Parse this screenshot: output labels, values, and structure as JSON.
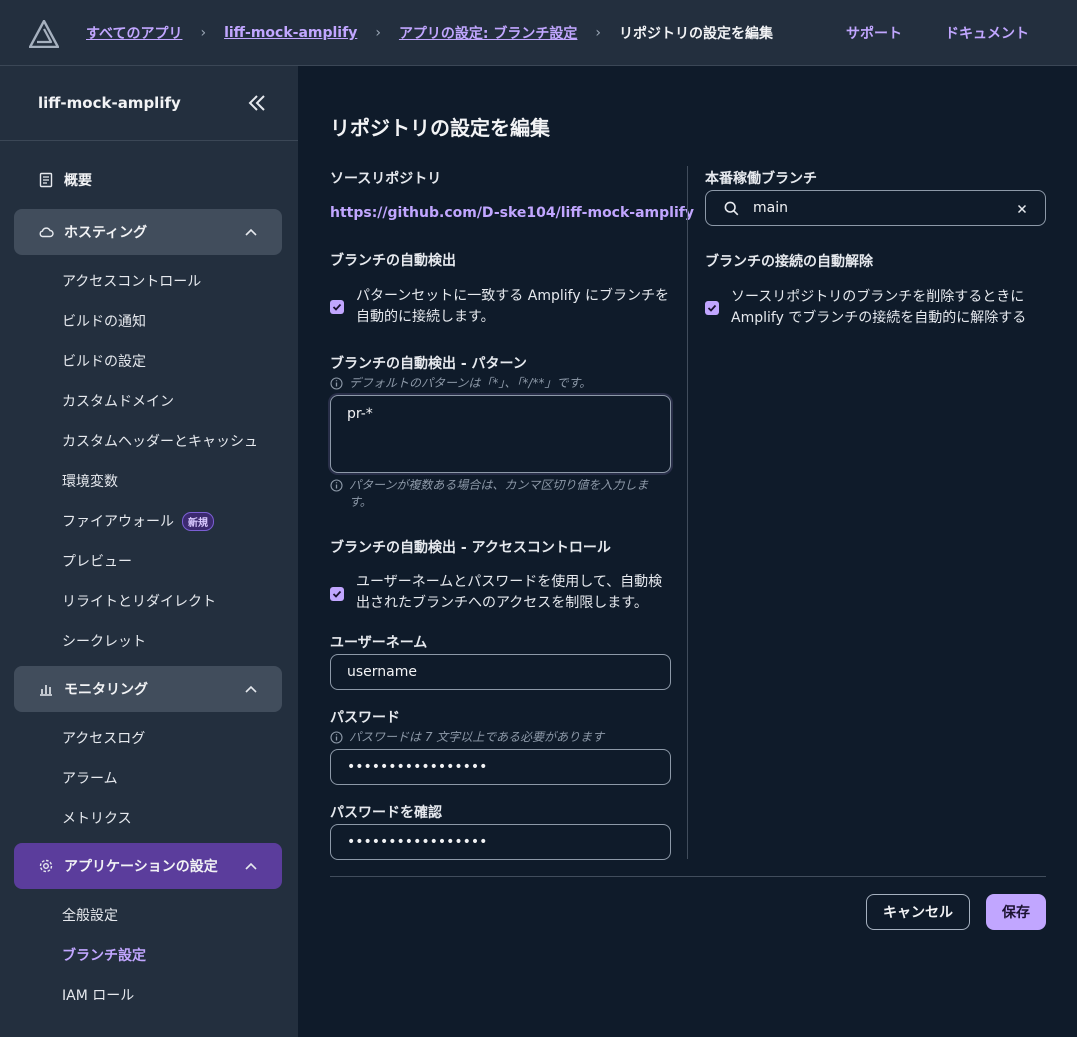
{
  "breadcrumb": {
    "items": [
      "すべてのアプリ",
      "liff-mock-amplify",
      "アプリの設定: ブランチ設定"
    ],
    "current": "リポジトリの設定を編集"
  },
  "header": {
    "support": "サポート",
    "docs": "ドキュメント"
  },
  "sidebar": {
    "app_name": "liff-mock-amplify",
    "overview": "概要",
    "hosting": {
      "label": "ホスティング",
      "items": [
        "アクセスコントロール",
        "ビルドの通知",
        "ビルドの設定",
        "カスタムドメイン",
        "カスタムヘッダーとキャッシュ",
        "環境変数",
        "ファイアウォール",
        "プレビュー",
        "リライトとリダイレクト",
        "シークレット"
      ],
      "new_badge": "新規"
    },
    "monitoring": {
      "label": "モニタリング",
      "items": [
        "アクセスログ",
        "アラーム",
        "メトリクス"
      ]
    },
    "app_settings": {
      "label": "アプリケーションの設定",
      "items": [
        "全般設定",
        "ブランチ設定",
        "IAM ロール"
      ]
    }
  },
  "main": {
    "title": "リポジトリの設定を編集",
    "source_repo_label": "ソースリポジトリ",
    "source_repo_url": "https://github.com/D-ske104/liff-mock-amplify",
    "auto_detect_label": "ブランチの自動検出",
    "auto_detect_checkbox": [
      "パターンセットに一致する Amplify にブランチを",
      "自動的に接続します。"
    ],
    "pattern_label": "ブランチの自動検出 - パターン",
    "pattern_hint": "デフォルトのパターンは「*」、「*/**」です。",
    "pattern_value": "pr-*",
    "pattern_help": [
      "パターンが複数ある場合は、カンマ区切り値を入力しま",
      "す。"
    ],
    "access_control_label": "ブランチの自動検出 - アクセスコントロール",
    "access_control_checkbox": [
      "ユーザーネームとパスワードを使用して、自動検",
      "出されたブランチへのアクセスを制限します。"
    ],
    "username_label": "ユーザーネーム",
    "username_value": "username",
    "password_label": "パスワード",
    "password_hint": "パスワードは 7 文字以上である必要があります",
    "password_value": "•••••••••••••••••",
    "confirm_label": "パスワードを確認",
    "confirm_value": "•••••••••••••••••",
    "production_branch_label": "本番稼働ブランチ",
    "production_branch_value": "main",
    "auto_disconnect_label": "ブランチの接続の自動解除",
    "auto_disconnect_checkbox": [
      "ソースリポジトリのブランチを削除するときに",
      "Amplify でブランチの接続を自動的に解除する"
    ],
    "cancel": "キャンセル",
    "save": "保存"
  }
}
